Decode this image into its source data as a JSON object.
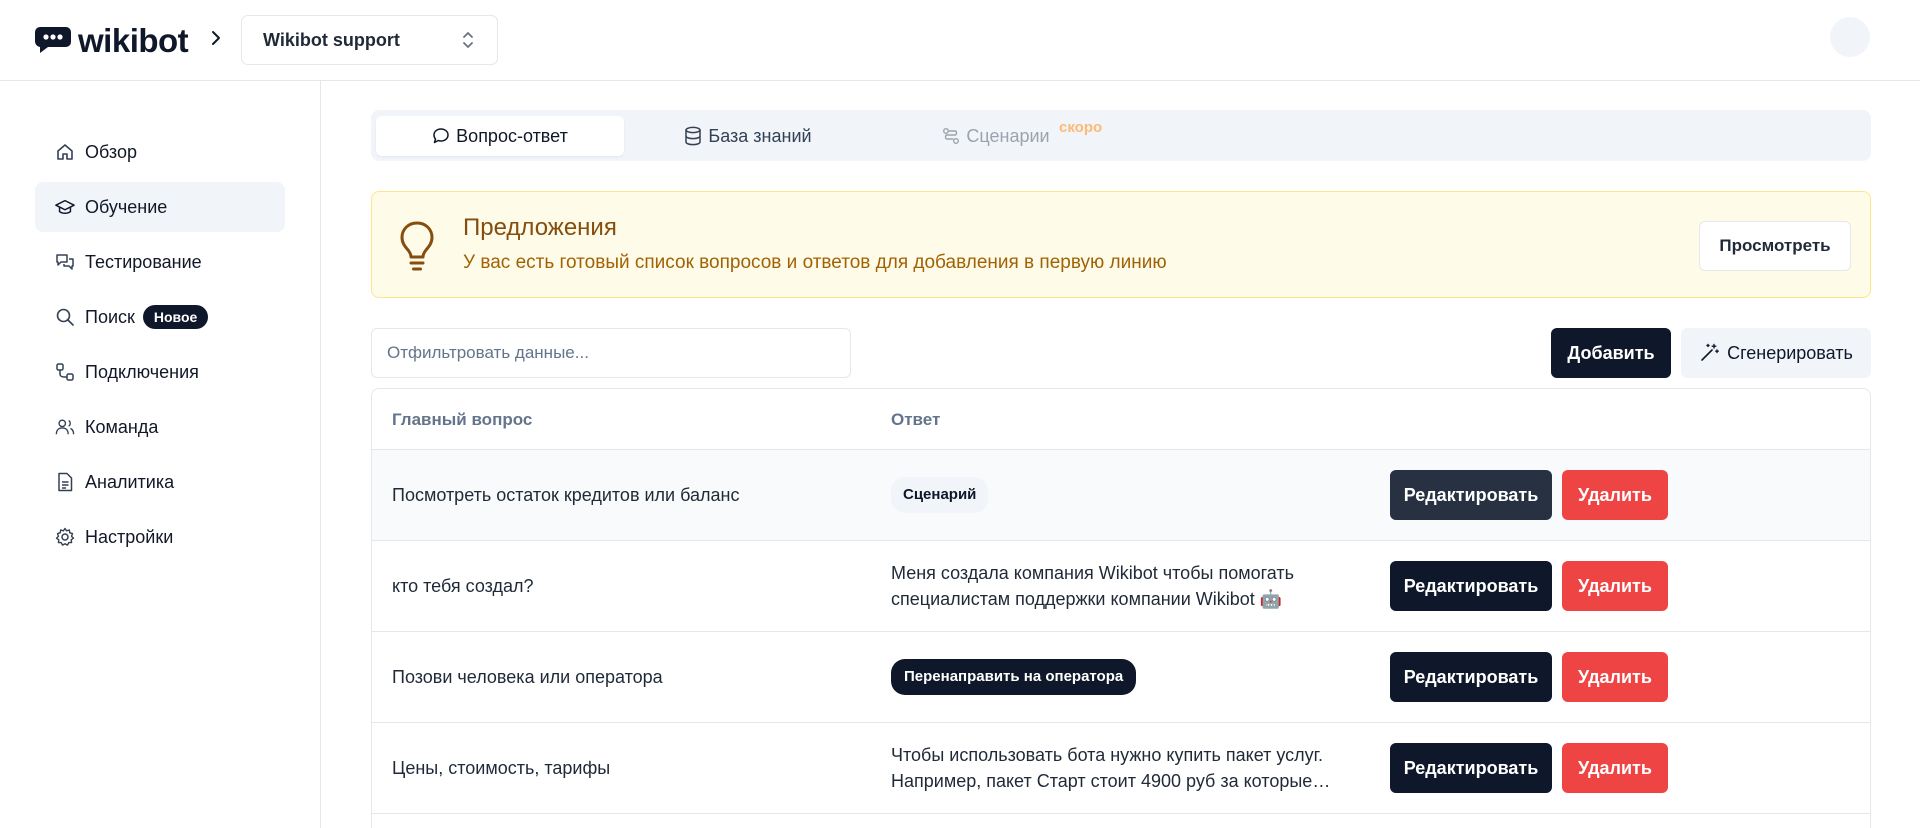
{
  "header": {
    "logo_text": "wikibot",
    "project_name": "Wikibot support"
  },
  "sidebar": {
    "items": [
      {
        "label": "Обзор",
        "icon": "home-icon",
        "active": false
      },
      {
        "label": "Обучение",
        "icon": "graduation-cap-icon",
        "active": true
      },
      {
        "label": "Тестирование",
        "icon": "chat-bubbles-icon",
        "active": false
      },
      {
        "label": "Поиск",
        "icon": "search-icon",
        "active": false,
        "badge": "Новое"
      },
      {
        "label": "Подключения",
        "icon": "connections-icon",
        "active": false
      },
      {
        "label": "Команда",
        "icon": "users-icon",
        "active": false
      },
      {
        "label": "Аналитика",
        "icon": "document-icon",
        "active": false
      },
      {
        "label": "Настройки",
        "icon": "gear-icon",
        "active": false
      }
    ]
  },
  "tabs": [
    {
      "label": "Вопрос-ответ",
      "icon": "message-icon",
      "state": "active"
    },
    {
      "label": "База знаний",
      "icon": "database-icon",
      "state": "normal"
    },
    {
      "label": "Сценарии",
      "icon": "workflow-icon",
      "state": "disabled",
      "note": "скоро"
    }
  ],
  "banner": {
    "title": "Предложения",
    "text": "У вас есть готовый список вопросов и ответов для добавления в первую линию",
    "button_label": "Просмотреть",
    "icon": "lightbulb-icon"
  },
  "toolbar": {
    "filter_placeholder": "Отфильтровать данные...",
    "add_label": "Добавить",
    "generate_label": "Сгенерировать",
    "generate_icon": "magic-wand-icon"
  },
  "table": {
    "columns": [
      "Главный вопрос",
      "Ответ"
    ],
    "edit_label": "Редактировать",
    "delete_label": "Удалить",
    "rows": [
      {
        "question": "Посмотреть остаток кредитов или баланс",
        "answer": "Сценарий",
        "answer_type": "tag-light"
      },
      {
        "question": "кто тебя создал?",
        "answer": "Меня создала компания Wikibot чтобы помогать специалистам поддержки компании Wikibot 🤖",
        "answer_type": "text"
      },
      {
        "question": "Позови человека или оператора",
        "answer": "Перенаправить на оператора",
        "answer_type": "tag-dark"
      },
      {
        "question": "Цены, стоимость, тарифы",
        "answer": "Чтобы использовать бота нужно купить пакет услуг. Например, пакет Старт стоит 4900 руб за которые вы...",
        "answer_type": "text"
      }
    ]
  },
  "colors": {
    "primary": "#0f172a",
    "danger": "#ef4444",
    "banner_bg": "#fefce8",
    "banner_border": "#fde68a",
    "soon": "#fdba74"
  }
}
